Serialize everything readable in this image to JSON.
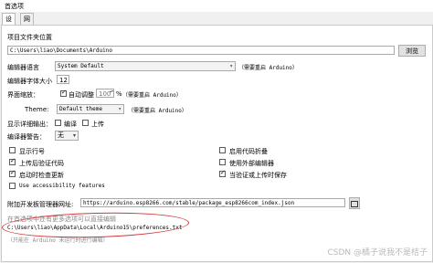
{
  "window": {
    "title": "首选项"
  },
  "tabs": [
    {
      "label": "设置"
    },
    {
      "label": "网络"
    }
  ],
  "sketchbook": {
    "label": "项目文件夹位置",
    "path": "C:\\Users\\liao\\Documents\\Arduino",
    "browse": "浏览"
  },
  "language": {
    "label": "编辑器语言",
    "value": "System Default",
    "note": "（需要重启 Arduino）"
  },
  "fontsize": {
    "label": "编辑器字体大小",
    "value": "12"
  },
  "scale": {
    "label": "界面缩放：",
    "auto_label": "自动调整",
    "value": "100",
    "unit": "%",
    "note": "（需要重启 Arduino）"
  },
  "theme": {
    "label": "Theme:",
    "value": "Default theme",
    "note": "（需要重启 Arduino）"
  },
  "verbose": {
    "label": "显示详细输出：",
    "compile": "编译",
    "upload": "上传"
  },
  "warnings": {
    "label": "编译器警告：",
    "value": "无"
  },
  "options": {
    "line_numbers": "显示行号",
    "code_folding": "启用代码折叠",
    "verify_upload": "上传后验证代码",
    "external_editor": "使用外部编辑器",
    "check_updates": "启动时检查更新",
    "save_on_verify": "当验证或上传时保存",
    "accessibility": "Use accessibility features"
  },
  "boards": {
    "label": "附加开发板管理器网址:",
    "url": "https://arduino.esp8266.com/stable/package_esp8266com_index.json"
  },
  "footer": {
    "hint": "在首选项中还有更多选项可以直接编辑",
    "prefs_path": "C:\\Users\\liao\\AppData\\Local\\Arduino15\\preferences.txt",
    "edit_note": "（只能在 Arduino 未运行时进行编辑）"
  },
  "watermark": "CSDN @橘子说我不是桔子"
}
